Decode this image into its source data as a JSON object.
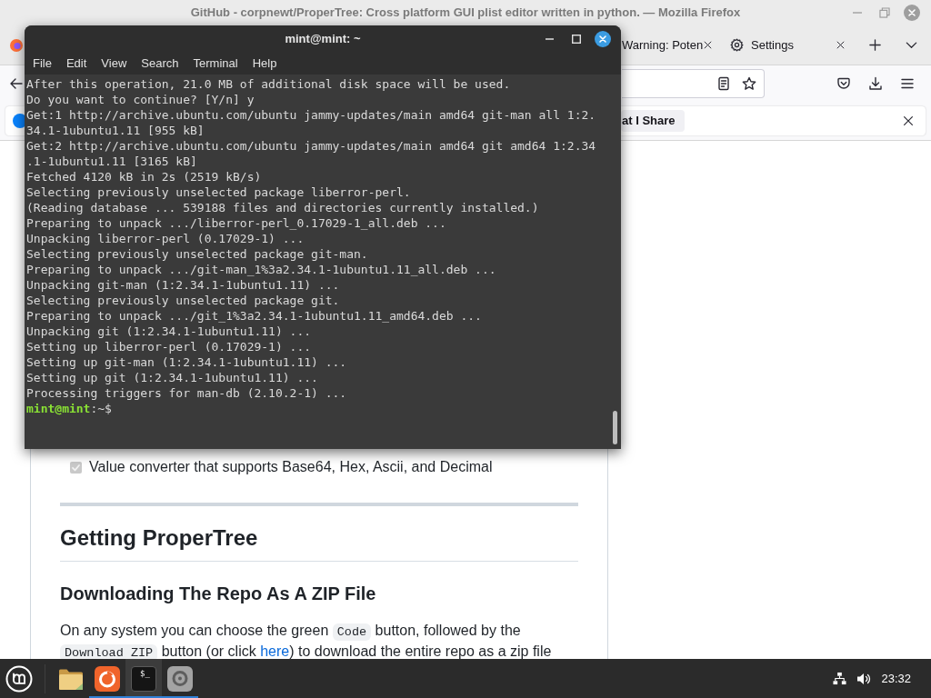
{
  "browser": {
    "title": "GitHub - corpnewt/ProperTree: Cross platform GUI plist editor written in python. — Mozilla Firefox",
    "tabs": [
      {
        "label": "Warning: Poten",
        "kind": "page",
        "selected": false
      },
      {
        "label": "Settings",
        "kind": "settings",
        "selected": false
      }
    ],
    "notification": {
      "button": "at I Share"
    },
    "page": {
      "task_item": {
        "text": "Value converter that supports Base64, Hex, Ascii, and Decimal",
        "checked": true
      },
      "heading": "Getting ProperTree",
      "subheading": "Downloading The Repo As A ZIP File",
      "paragraph": [
        {
          "kind": "text",
          "text": "On any system you can choose the green "
        },
        {
          "kind": "code",
          "text": "Code"
        },
        {
          "kind": "text",
          "text": " button, followed by the "
        },
        {
          "kind": "code",
          "text": "Download ZIP"
        },
        {
          "kind": "text",
          "text": " button (or click "
        },
        {
          "kind": "link",
          "text": "here"
        },
        {
          "kind": "text",
          "text": ") to download the entire repo as a zip file"
        }
      ]
    }
  },
  "terminal": {
    "title": "mint@mint: ~",
    "menu": [
      "File",
      "Edit",
      "View",
      "Search",
      "Terminal",
      "Help"
    ],
    "lines": [
      "After this operation, 21.0 MB of additional disk space will be used.",
      "Do you want to continue? [Y/n] y",
      "Get:1 http://archive.ubuntu.com/ubuntu jammy-updates/main amd64 git-man all 1:2.",
      "34.1-1ubuntu1.11 [955 kB]",
      "Get:2 http://archive.ubuntu.com/ubuntu jammy-updates/main amd64 git amd64 1:2.34",
      ".1-1ubuntu1.11 [3165 kB]",
      "Fetched 4120 kB in 2s (2519 kB/s)",
      "Selecting previously unselected package liberror-perl.",
      "(Reading database ... 539188 files and directories currently installed.)",
      "Preparing to unpack .../liberror-perl_0.17029-1_all.deb ...",
      "Unpacking liberror-perl (0.17029-1) ...",
      "Selecting previously unselected package git-man.",
      "Preparing to unpack .../git-man_1%3a2.34.1-1ubuntu1.11_all.deb ...",
      "Unpacking git-man (1:2.34.1-1ubuntu1.11) ...",
      "Selecting previously unselected package git.",
      "Preparing to unpack .../git_1%3a2.34.1-1ubuntu1.11_amd64.deb ...",
      "Unpacking git (1:2.34.1-1ubuntu1.11) ...",
      "Setting up liberror-perl (0.17029-1) ...",
      "Setting up git-man (1:2.34.1-1ubuntu1.11) ...",
      "Setting up git (1:2.34.1-1ubuntu1.11) ...",
      "Processing triggers for man-db (2.10.2-1) ..."
    ],
    "prompt": "**mint@mint**:~$"
  },
  "taskbar": {
    "apps": [
      {
        "kind": "files",
        "running": false,
        "active": false
      },
      {
        "kind": "browser",
        "running": true,
        "active": false
      },
      {
        "kind": "terminal",
        "glyph": "$_",
        "running": true,
        "active": true
      },
      {
        "kind": "ring",
        "running": true,
        "active": false
      }
    ],
    "clock": "23:32"
  }
}
